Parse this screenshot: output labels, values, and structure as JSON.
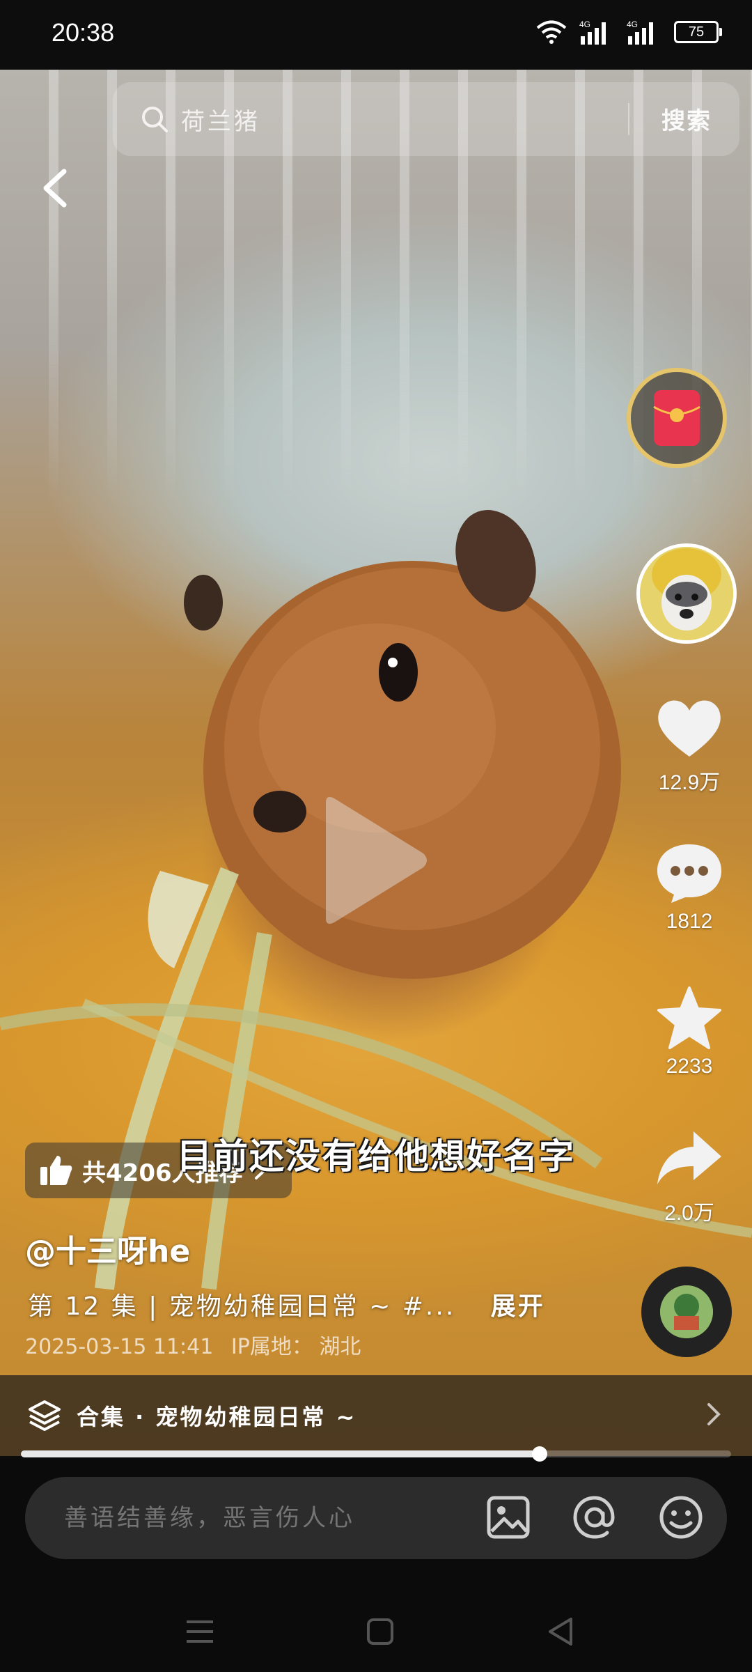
{
  "status": {
    "time": "20:38",
    "battery": "75",
    "network_1": "4G",
    "network_2": "4G"
  },
  "search": {
    "query": "荷兰猪",
    "button": "搜索"
  },
  "video": {
    "subtitle": "目前还没有给他想好名字"
  },
  "rail": {
    "likes": "12.9万",
    "comments": "1812",
    "favorites": "2233",
    "shares": "2.0万"
  },
  "info": {
    "recommend": "共4206人推荐",
    "author": "@十三呀he",
    "description": "第 12 集 | 宠物幼稚园日常 ~ #...",
    "expand": "展开",
    "timestamp": "2025-03-15 11:41",
    "ip_location": "IP属地： 湖北"
  },
  "collection": {
    "label": "合集 · 宠物幼稚园日常 ~"
  },
  "progress": {
    "fraction": 0.73
  },
  "comment": {
    "placeholder": "善语结善缘，恶言伤人心"
  },
  "icons": [
    "wifi-icon",
    "signal-icon",
    "battery-icon",
    "back-icon",
    "search-icon",
    "play-icon",
    "red-packet-icon",
    "heart-icon",
    "comment-icon",
    "star-icon",
    "share-icon",
    "music-disc-icon",
    "thumbs-up-icon",
    "layers-icon",
    "chevron-right-icon",
    "image-icon",
    "at-icon",
    "emoji-icon",
    "menu-nav-icon",
    "home-nav-icon",
    "back-nav-icon"
  ],
  "colors": {
    "accent_gold": "#e6c46a",
    "red_packet": "#e8344e"
  }
}
